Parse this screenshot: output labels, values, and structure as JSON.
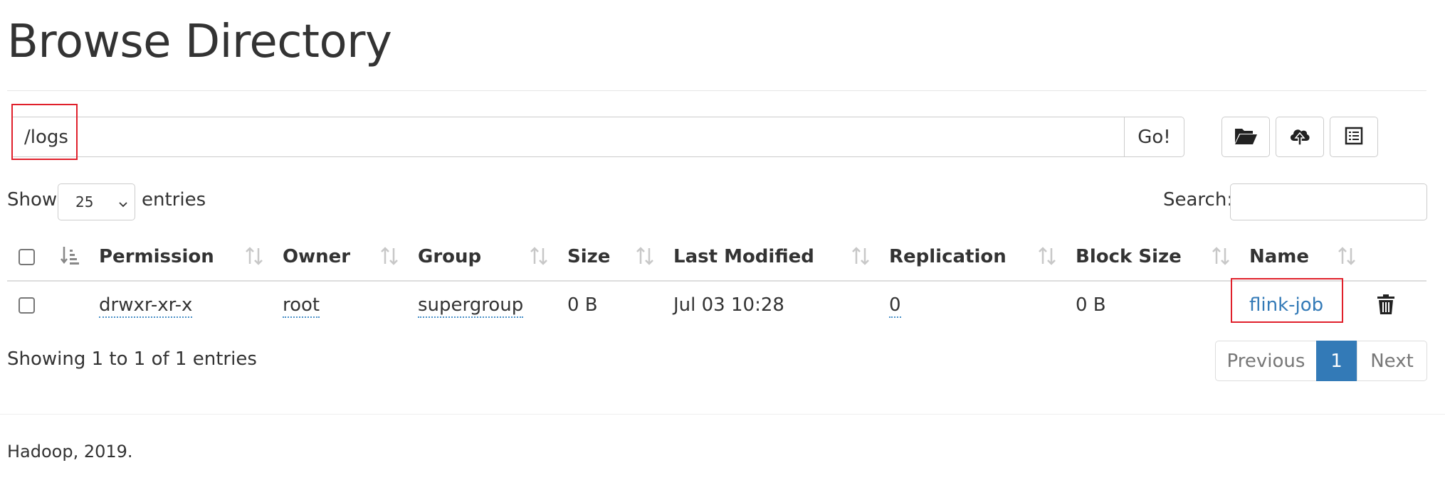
{
  "header": {
    "title": "Browse Directory"
  },
  "path_bar": {
    "value": "/logs",
    "go_label": "Go!"
  },
  "toolbar": {
    "icons": [
      "folder-open-icon",
      "cloud-upload-icon",
      "list-icon"
    ]
  },
  "table_controls": {
    "show_label": "Show",
    "page_length": "25",
    "entries_label": "entries",
    "search_label": "Search:",
    "search_value": ""
  },
  "table": {
    "columns": [
      "Permission",
      "Owner",
      "Group",
      "Size",
      "Last Modified",
      "Replication",
      "Block Size",
      "Name"
    ],
    "rows": [
      {
        "permission": "drwxr-xr-x",
        "owner": "root",
        "group": "supergroup",
        "size": "0 B",
        "last_modified": "Jul 03 10:28",
        "replication": "0",
        "block_size": "0 B",
        "name": "flink-job"
      }
    ]
  },
  "table_info": "Showing 1 to 1 of 1 entries",
  "pagination": {
    "previous": "Previous",
    "current": "1",
    "next": "Next"
  },
  "footer": {
    "text": "Hadoop, 2019."
  },
  "colors": {
    "link": "#337ab7",
    "highlight": "#e0202b",
    "page_active": "#337ab7"
  }
}
